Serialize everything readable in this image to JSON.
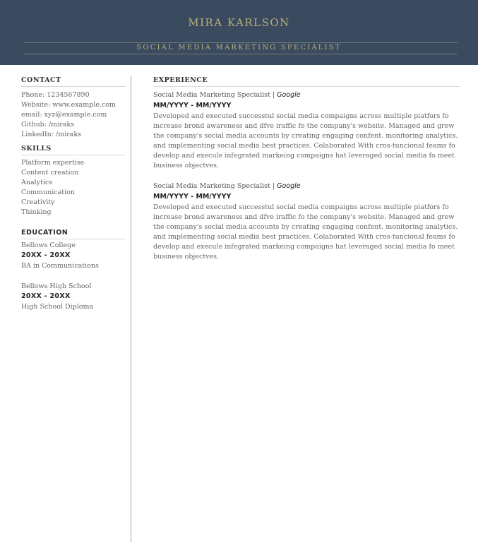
{
  "header": {
    "name": "MIRA KARLSON",
    "title": "SOCIAL MEDIA MARKETING SPECIALIST"
  },
  "contact": {
    "heading": "CONTACT",
    "phone": "Phone: 1234567890",
    "website": "Website: www.example.com",
    "email": "email: xyz@example.com",
    "github": "Github: /miraks",
    "linkedin": "LinkedIn: /miraks"
  },
  "skills": {
    "heading": "SKILLS",
    "items": [
      "Platform expertise",
      "Content creation",
      "Analytics",
      "Communication",
      "Creativity",
      "Thinking"
    ]
  },
  "education": {
    "heading": "EDUCATION",
    "entries": [
      {
        "school": "Bellows College",
        "dates": "20XX - 20XX",
        "degree": "BA in Communications"
      },
      {
        "school": "Bellows High School",
        "dates": "20XX - 20XX",
        "degree": "High School Diploma"
      }
    ]
  },
  "experience": {
    "heading": "EXPERIENCE",
    "jobs": [
      {
        "title": "Social Media Marketing Specialist",
        "separator": " | ",
        "company": "Google",
        "dates": "MM/YYYY - MM/YYYY",
        "description": "Developed and executed successtul social media compaigns across multiple piatfors fo increase brond awareness and dfve iraffic fo the company's website. Managed and grew the company's social media accounts by creating engaging confent. monitoring analytics. and implementing social media best practices. Colaborated With cros-tuncional feams fo develop and execule infegrated markeing compaigns hat leveraged social media fo meet business objectves."
      },
      {
        "title": "Social Media Marketing Specialist",
        "separator": " | ",
        "company": "Google",
        "dates": "MM/YYYY - MM/YYYY",
        "description": "Developed and executed successtul social media compaigns across multiple piatfors fo increase brond awareness and dfve iraffic fo the company's website. Managed and grew the company's social media accounts by creating engaging confent. monitoring analytics. and implementing social media best practices. Colaborated With cros-tuncional feams fo develop and execule infegrated markeing compaigns hat leveraged social media fo meet business objectves."
      }
    ]
  },
  "colors": {
    "header_bg": "#3b4b5f",
    "accent_gold": "#b8ad7c",
    "divider": "#a9a28a"
  }
}
